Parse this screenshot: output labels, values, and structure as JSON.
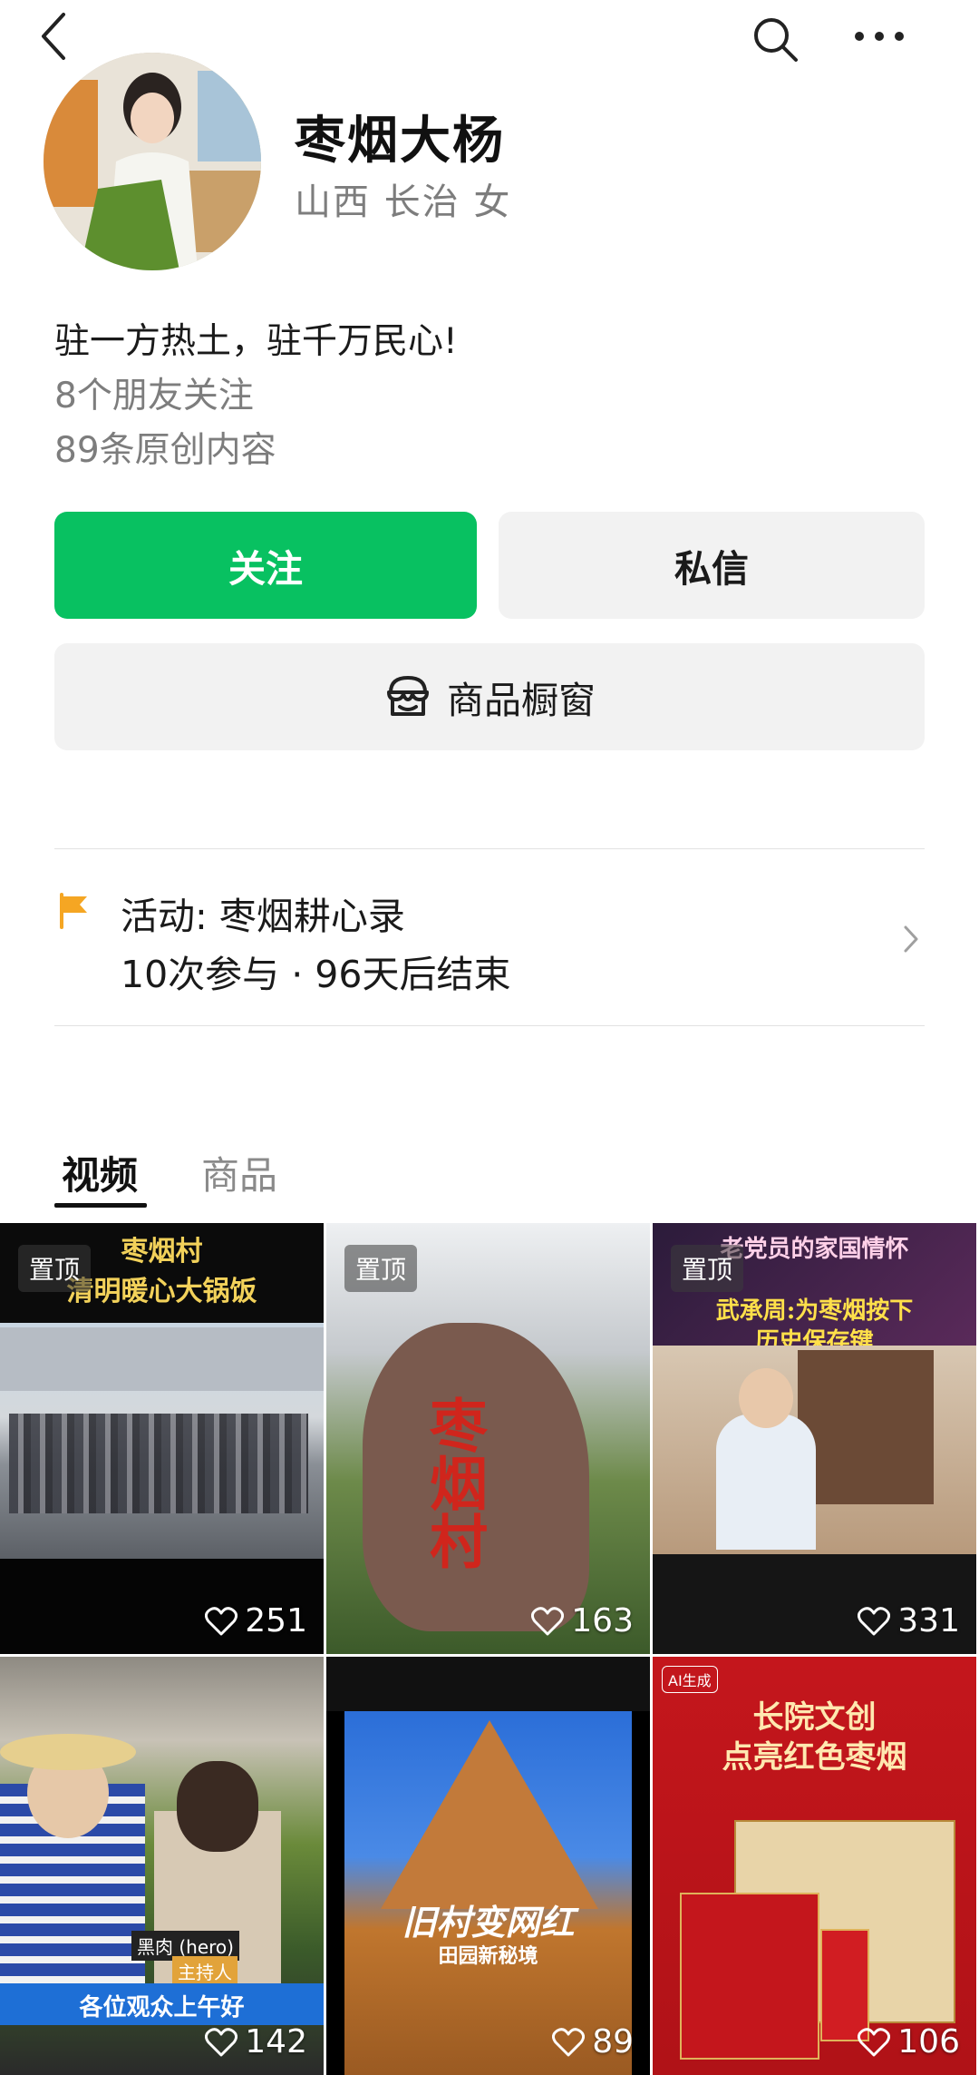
{
  "profile": {
    "name": "枣烟大杨",
    "meta": "山西 长治 女",
    "bio": "驻一方热土，驻千万民心!",
    "friends": "8个朋友关注",
    "original": "89条原创内容"
  },
  "actions": {
    "follow": "关注",
    "message": "私信",
    "shop": "商品橱窗"
  },
  "activity": {
    "title": "活动: 枣烟耕心录",
    "sub": "10次参与 · 96天后结束"
  },
  "tabs": [
    "视频",
    "商品"
  ],
  "videos": [
    {
      "pinned": "置顶",
      "likes": "251",
      "title": "枣烟村\n清明暖心大锅饭"
    },
    {
      "pinned": "置顶",
      "likes": "163",
      "title": "枣烟村"
    },
    {
      "pinned": "置顶",
      "likes": "331",
      "title": "老党员的家国情怀",
      "subtitle": "武承周:为枣烟按下\n历史保存键"
    },
    {
      "likes": "142",
      "caption": "各位观众上午好",
      "tag1": "黑肉 (hero)",
      "tag2": "主持人"
    },
    {
      "likes": "89",
      "title": "旧村变网红",
      "subtitle": "田园新秘境"
    },
    {
      "likes": "106",
      "title": "长院文创\n点亮红色枣烟",
      "badge": "AI生成"
    }
  ],
  "colors": {
    "accent": "#08c161",
    "flag": "#f5a623"
  }
}
